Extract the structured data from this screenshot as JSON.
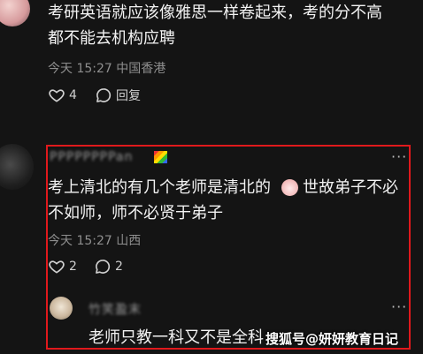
{
  "comment1": {
    "text_line1": "考研英语就应该像雅思一样卷起来，考的分不高",
    "text_line2": "都不能去机构应聘",
    "meta": "今天 15:27 中国香港",
    "likes": "4",
    "reply_label": "回复"
  },
  "comment2": {
    "username": "PPPPPPPPan",
    "text_line1": "考上清北的有几个老师是清北的",
    "text_line1b": "世故弟子不必",
    "text_line2": "不如师，师不必贤于弟子",
    "meta": "今天 15:27 山西",
    "likes": "2",
    "replies": "2",
    "more": "···"
  },
  "reply1": {
    "username": "竹笑盈末",
    "text": "老师只教一科又不是全科",
    "more": "···"
  },
  "watermark": "搜狐号@妍妍教育日记",
  "colors": {
    "highlight": "#e0191c",
    "background": "#141414"
  },
  "icons": [
    "heart-icon",
    "comment-bubble-icon",
    "more-dots-icon",
    "clown-emoji-icon",
    "rainbow-flag-icon"
  ]
}
